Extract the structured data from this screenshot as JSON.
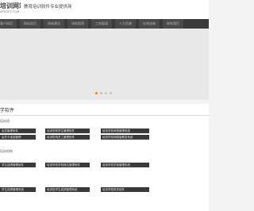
{
  "header": {
    "logo_text": "培训网站",
    "logo_subtext": "XPSOFT.COM",
    "slogan": "教育培训软件专业提供商"
  },
  "nav": {
    "items": [
      {
        "label": "客户网页"
      },
      {
        "label": "网站首页"
      },
      {
        "label": "网站建设"
      },
      {
        "label": "场地租赁"
      },
      {
        "label": "工商管理"
      },
      {
        "label": "人力资源"
      },
      {
        "label": "在线咨询"
      },
      {
        "label": "联系我们"
      }
    ]
  },
  "slider": {
    "dots": 4,
    "active_index": 0
  },
  "section": {
    "title": "学软件"
  },
  "groups": [
    {
      "label": "培训班",
      "rows": [
        [
          "会员管理软件",
          "培训学校学生管理软件",
          "培训学校考勤管理系统"
        ],
        [
          "会员卡连锁管理",
          "培训机构员工管理软件",
          "培训学校网络版教务系统"
        ]
      ]
    },
    {
      "label": "培训机构",
      "rows": [
        [
          "学生成绩管理软件",
          "培训学校学校报名管理软件",
          "培训学校学费管理系统"
        ]
      ]
    },
    {
      "label": "",
      "rows": [
        [
          "学生成绩管理系统",
          "培训班学生成绩管理系统",
          "培训学校财务软件"
        ]
      ]
    }
  ]
}
